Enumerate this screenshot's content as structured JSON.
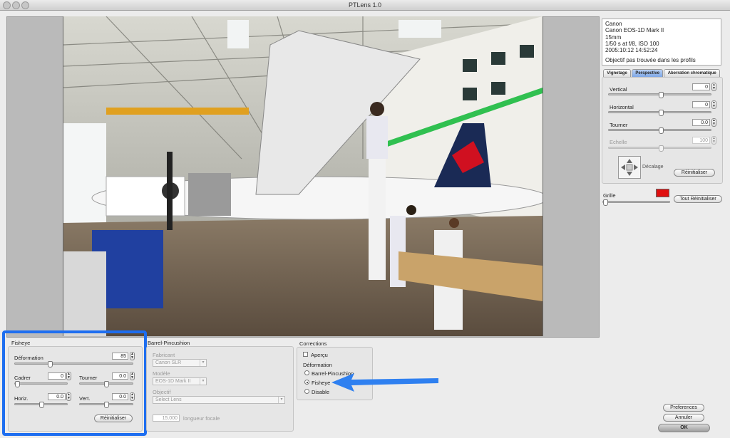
{
  "window": {
    "title": "PTLens 1.0"
  },
  "exif": {
    "make": "Canon",
    "model": "Canon EOS-1D Mark II",
    "focal": "15mm",
    "exposure": "1/50 s at f/8, ISO 100",
    "date": "2005:10:12 14:52:24",
    "profile_msg": "Objectif pas trouvée dans les profils"
  },
  "tabs": [
    "Vignetage",
    "Perspective",
    "Aberration chromatique"
  ],
  "perspective": {
    "vertical_label": "Vertical",
    "vertical_value": "0",
    "horizontal_label": "Horizontal",
    "horizontal_value": "0",
    "tourner_label": "Tourner",
    "tourner_value": "0.0",
    "echelle_label": "Echelle",
    "echelle_value": "100",
    "decalage_label": "Décalage",
    "reset_label": "Réinitialiser"
  },
  "grille": {
    "label": "Grille",
    "color": "#e01010",
    "reset_all_label": "Tout Réinitialiser"
  },
  "fisheye": {
    "title": "Fisheye",
    "deformation_label": "Déformation",
    "deformation_value": "85",
    "cadrer_label": "Cadrer",
    "cadrer_value": "0",
    "tourner_label": "Tourner",
    "tourner_value": "0.0",
    "horiz_label": "Horiz.",
    "horiz_value": "0.0",
    "vert_label": "Vert.",
    "vert_value": "0.0",
    "reset_label": "Réinitialiser",
    "highlight_color": "#1e6ef0"
  },
  "barrel": {
    "title": "Barrel-Pincushion",
    "fabricant_label": "Fabricant",
    "fabricant_value": "Canon SLR",
    "modele_label": "Modèle",
    "modele_value": "EOS-1D Mark II",
    "objectif_label": "Objectif",
    "objectif_value": "Select Lens",
    "focal_value": "15.000",
    "focal_label": "longueur focale"
  },
  "corrections": {
    "title": "Corrections",
    "apercu_label": "Aperçu",
    "deformation_label": "Déformation",
    "options": [
      "Barrel-Pincushion",
      "Fisheye",
      "Disable"
    ],
    "selected": "Fisheye",
    "arrow_color": "#2f80f0"
  },
  "footer": {
    "preferences": "Preferences",
    "annuler": "Annuler",
    "ok": "OK"
  }
}
